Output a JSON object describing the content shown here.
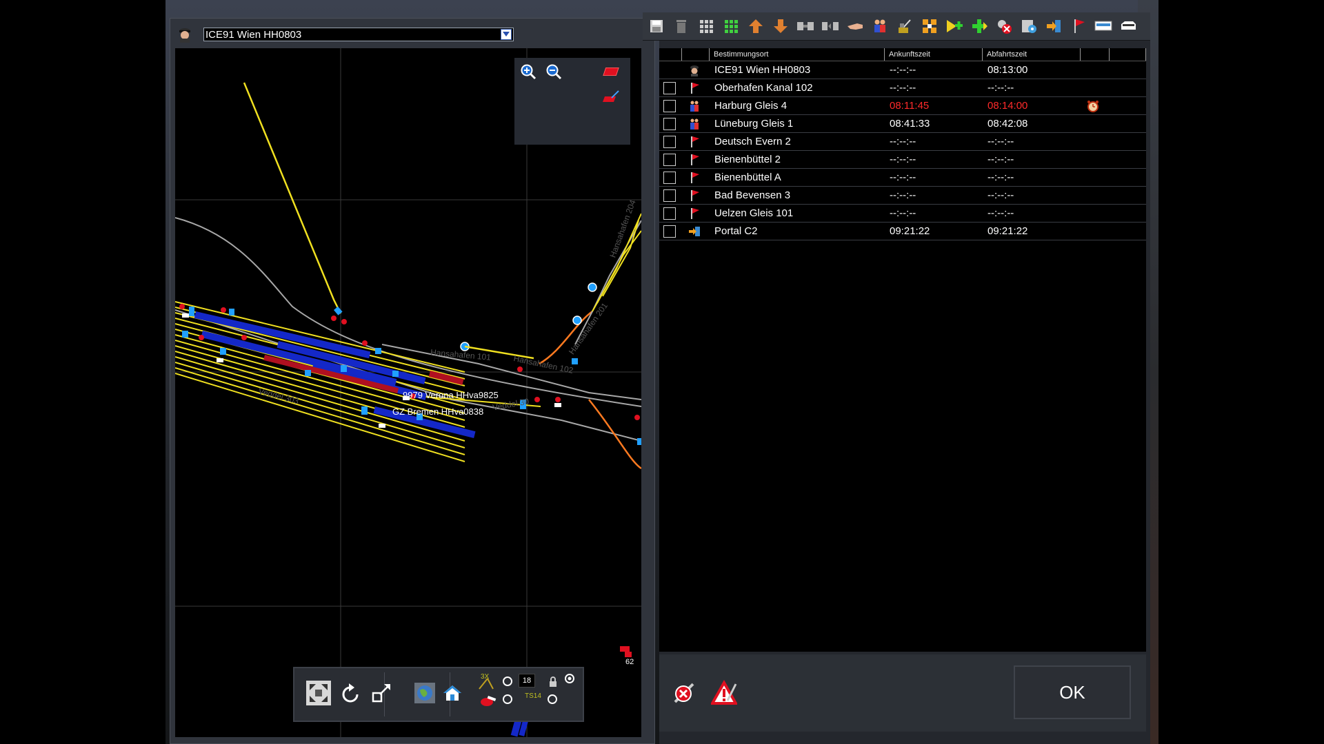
{
  "train_selector": {
    "value": "ICE91 Wien HH0803"
  },
  "map": {
    "labels": {
      "train_a": "9979 Verona HHva9825",
      "train_b": "GZ Bremen HHva0838",
      "hansahafen_101": "Hansahafen 101",
      "hansahafen_102": "Hansahafen 102",
      "veddel_303": "Veddel 303",
      "veddel_30": "Veddel 30",
      "hansahafen_201": "Hansahafen 201",
      "hansahafen_204": "Hansahafen 204",
      "platform_62": "62"
    },
    "counter": "18",
    "ts_label": "TS14",
    "speed_label": "3X"
  },
  "orders": {
    "columns": {
      "destination": "Bestimmungsort",
      "arrival": "Ankunftszeit",
      "departure": "Abfahrtszeit"
    },
    "rows": [
      {
        "destination": "ICE91 Wien HH0803",
        "arrival": "--:--:--",
        "departure": "08:13:00",
        "icon": "driver-icon",
        "has_checkbox": false,
        "late": false
      },
      {
        "destination": "Oberhafen Kanal 102",
        "arrival": "--:--:--",
        "departure": "--:--:--",
        "icon": "flag-icon",
        "has_checkbox": true,
        "late": false
      },
      {
        "destination": "Harburg Gleis 4",
        "arrival": "08:11:45",
        "departure": "08:14:00",
        "icon": "passengers-icon",
        "has_checkbox": true,
        "late": true,
        "alarm": true
      },
      {
        "destination": "Lüneburg Gleis 1",
        "arrival": "08:41:33",
        "departure": "08:42:08",
        "icon": "passengers-icon",
        "has_checkbox": true,
        "late": false
      },
      {
        "destination": "Deutsch Evern 2",
        "arrival": "--:--:--",
        "departure": "--:--:--",
        "icon": "flag-icon",
        "has_checkbox": true,
        "late": false
      },
      {
        "destination": "Bienenbüttel 2",
        "arrival": "--:--:--",
        "departure": "--:--:--",
        "icon": "flag-icon",
        "has_checkbox": true,
        "late": false
      },
      {
        "destination": "Bienenbüttel A",
        "arrival": "--:--:--",
        "departure": "--:--:--",
        "icon": "flag-icon",
        "has_checkbox": true,
        "late": false
      },
      {
        "destination": "Bad Bevensen 3",
        "arrival": "--:--:--",
        "departure": "--:--:--",
        "icon": "flag-icon",
        "has_checkbox": true,
        "late": false
      },
      {
        "destination": "Uelzen Gleis 101",
        "arrival": "--:--:--",
        "departure": "--:--:--",
        "icon": "flag-icon",
        "has_checkbox": true,
        "late": false
      },
      {
        "destination": "Portal C2",
        "arrival": "09:21:22",
        "departure": "09:21:22",
        "icon": "portal-icon",
        "has_checkbox": true,
        "late": false
      }
    ]
  },
  "buttons": {
    "ok": "OK"
  },
  "colors": {
    "late_text": "#ff2a2a",
    "track_yellow": "#f0e020",
    "track_grey": "#a8a8a8",
    "track_orange": "#ff7a20",
    "wagon_blue": "#1428c8",
    "signal_red": "#e01020",
    "marker_cyan": "#20a0ff"
  }
}
